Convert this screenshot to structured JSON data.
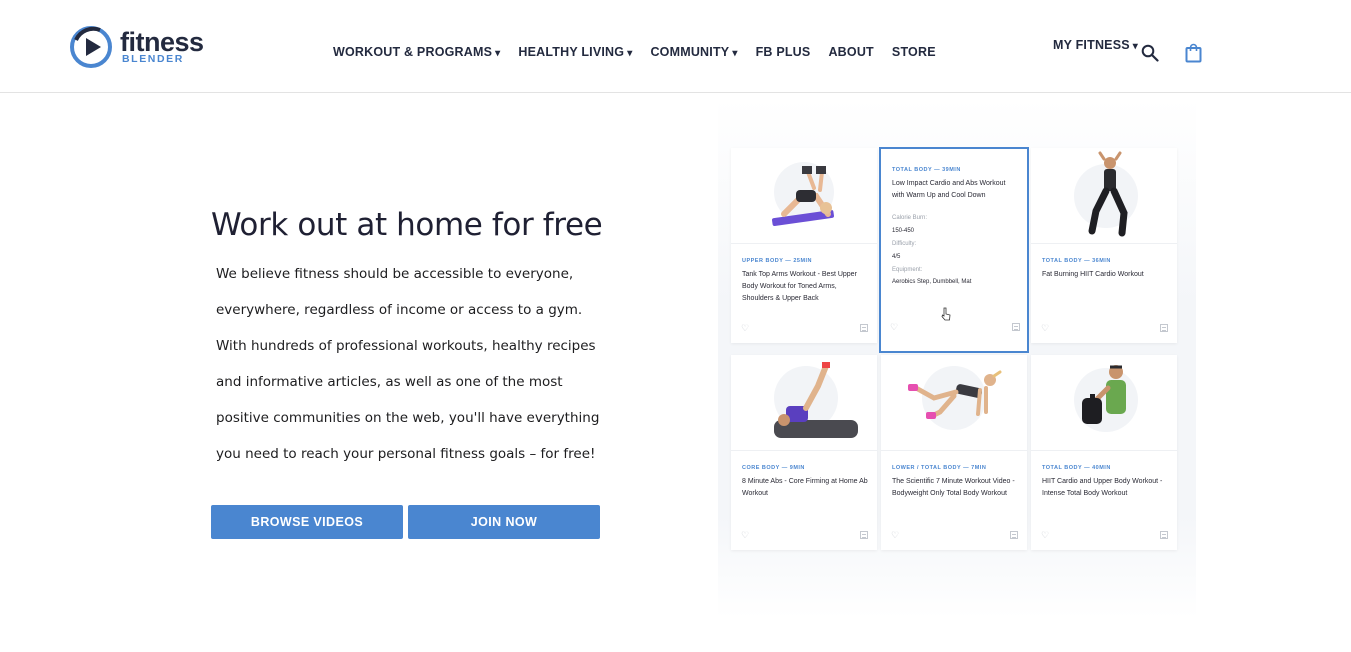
{
  "header": {
    "logo": {
      "word": "fitness",
      "sub": "BLENDER"
    },
    "nav": [
      {
        "label": "WORKOUT & PROGRAMS",
        "dropdown": true
      },
      {
        "label": "HEALTHY LIVING",
        "dropdown": true
      },
      {
        "label": "COMMUNITY",
        "dropdown": true
      },
      {
        "label": "FB PLUS",
        "dropdown": false
      },
      {
        "label": "ABOUT",
        "dropdown": false
      },
      {
        "label": "STORE",
        "dropdown": false
      }
    ],
    "my_fitness": "MY FITNESS",
    "caret": "▾",
    "icons": {
      "search": "search-icon",
      "bag": "shopping-bag-icon"
    }
  },
  "hero": {
    "title": "Work out at home for free",
    "copy": "We believe fitness should be accessible to everyone, everywhere, regardless of income or access to a gym. With hundreds of professional workouts, healthy recipes and informative articles, as well as one of the most positive communities on the web, you'll have everything you need to reach your personal fitness goals – for free!",
    "buttons": {
      "browse": "BROWSE VIDEOS",
      "join": "JOIN NOW"
    }
  },
  "cards": [
    {
      "category": "UPPER BODY — 25MIN",
      "title": "Tank Top Arms Workout - Best Upper Body Workout for Toned Arms, Shoulders & Upper Back"
    },
    {
      "category": "TOTAL BODY — 39MIN",
      "title": "Low Impact Cardio and Abs Workout with Warm Up and Cool Down",
      "calorie_label": "Calorie Burn:",
      "calorie_value": "150-450",
      "difficulty_label": "Difficulty:",
      "difficulty_value": "4/5",
      "equipment_label": "Equipment:",
      "equipment_value": "Aerobics Step, Dumbbell, Mat"
    },
    {
      "category": "TOTAL BODY — 36MIN",
      "title": "Fat Burning HIIT Cardio Workout"
    },
    {
      "category": "CORE BODY — 9MIN",
      "title": "8 Minute Abs - Core Firming at Home Ab Workout"
    },
    {
      "category": "LOWER / TOTAL BODY — 7MIN",
      "title": "The Scientific 7 Minute Workout Video - Bodyweight Only Total Body Workout"
    },
    {
      "category": "TOTAL BODY — 40MIN",
      "title": "HIIT Cardio and Upper Body Workout - Intense Total Body Workout"
    }
  ],
  "card_icons": {
    "heart": "♡",
    "calendar": "calendar-icon"
  },
  "colors": {
    "accent": "#4a86d0",
    "navy": "#232a3f"
  }
}
